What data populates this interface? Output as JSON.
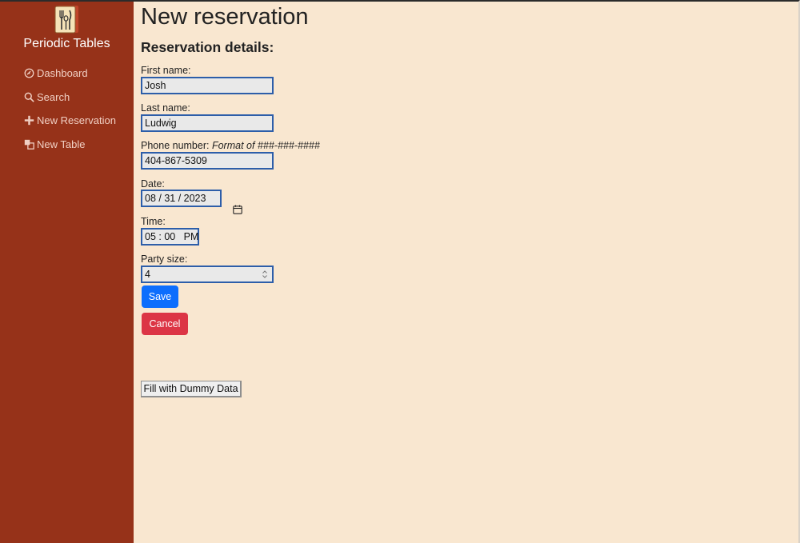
{
  "sidebar": {
    "brand": "Periodic Tables",
    "logo_icon": "utensils-menu-icon",
    "items": [
      {
        "label": "Dashboard",
        "icon": "dashboard-icon"
      },
      {
        "label": "Search",
        "icon": "search-icon"
      },
      {
        "label": "New Reservation",
        "icon": "plus-icon"
      },
      {
        "label": "New Table",
        "icon": "table-layers-icon"
      }
    ]
  },
  "main": {
    "title": "New reservation",
    "section_title": "Reservation details:",
    "form": {
      "first_name_label": "First name:",
      "first_name_value": "Josh",
      "last_name_label": "Last name:",
      "last_name_value": "Ludwig",
      "phone_label": "Phone number:",
      "phone_hint": "Format of ###-###-####",
      "phone_value": "404-867-5309",
      "date_label": "Date:",
      "date_value": "08 / 31 / 2023",
      "time_label": "Time:",
      "time_value": "05 : 00   PM",
      "party_label": "Party size:",
      "party_value": "4"
    },
    "buttons": {
      "save": "Save",
      "cancel": "Cancel",
      "dummy": "Fill with Dummy Data"
    }
  },
  "colors": {
    "sidebar_bg": "#963219",
    "main_bg": "#f9e7d0",
    "save": "#0d6efd",
    "cancel": "#dc3545",
    "input_border": "#2d5ea9"
  }
}
